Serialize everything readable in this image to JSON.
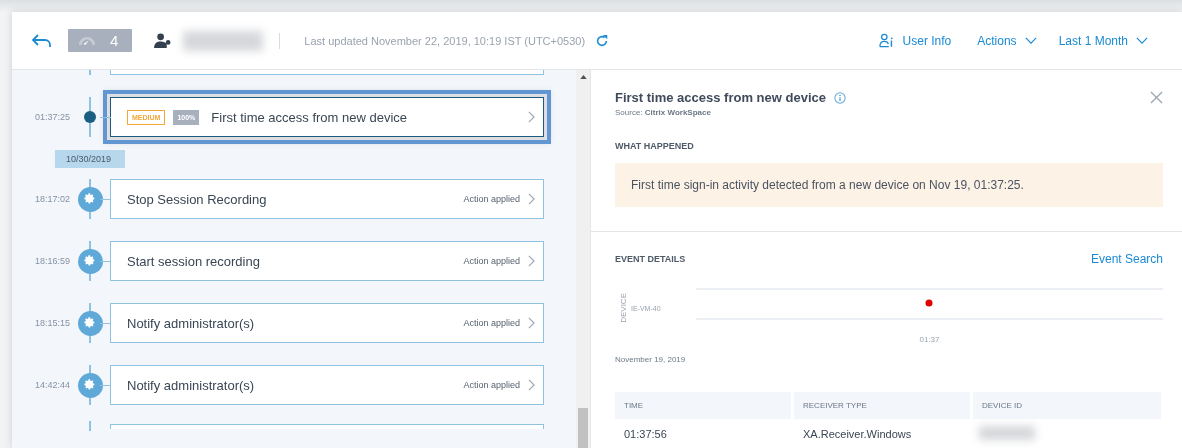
{
  "header": {
    "risk_score": "4",
    "last_updated": "Last updated November 22, 2019, 10:19 IST (UTC+0530)",
    "user_info": "User Info",
    "actions": "Actions",
    "period": "Last 1 Month"
  },
  "timeline": [
    {
      "kind": "event",
      "time": "01:37:25",
      "severity": "MEDIUM",
      "confidence": "100%",
      "title": "First time access from new device",
      "selected": true
    },
    {
      "kind": "date",
      "label": "10/30/2019"
    },
    {
      "kind": "action",
      "time": "18:17:02",
      "title": "Stop Session Recording",
      "status": "Action applied",
      "selected": false
    },
    {
      "kind": "action",
      "time": "18:16:59",
      "title": "Start session recording",
      "status": "Action applied",
      "selected": false
    },
    {
      "kind": "action",
      "time": "18:15:15",
      "title": "Notify administrator(s)",
      "status": "Action applied",
      "selected": false
    },
    {
      "kind": "action",
      "time": "14:42:44",
      "title": "Notify administrator(s)",
      "status": "Action applied",
      "selected": false
    }
  ],
  "detail": {
    "title": "First time access from new device",
    "source": "Source: **Citrix WorkSpace**",
    "what_happened_heading": "WHAT HAPPENED",
    "what_happened": "First time sign-in activity detected from a new device on Nov 19, 01:37:25.",
    "event_details_heading": "EVENT DETAILS",
    "event_search": "Event Search",
    "chart": {
      "axis_label": "DEVICE",
      "category": "IE-VM-40",
      "tick": "01:37",
      "date": "November 19, 2019"
    },
    "table": {
      "columns": [
        "TIME",
        "RECEIVER TYPE",
        "DEVICE ID"
      ],
      "rows": [
        [
          "01:37:56",
          "XA.Receiver.Windows"
        ]
      ]
    }
  }
}
